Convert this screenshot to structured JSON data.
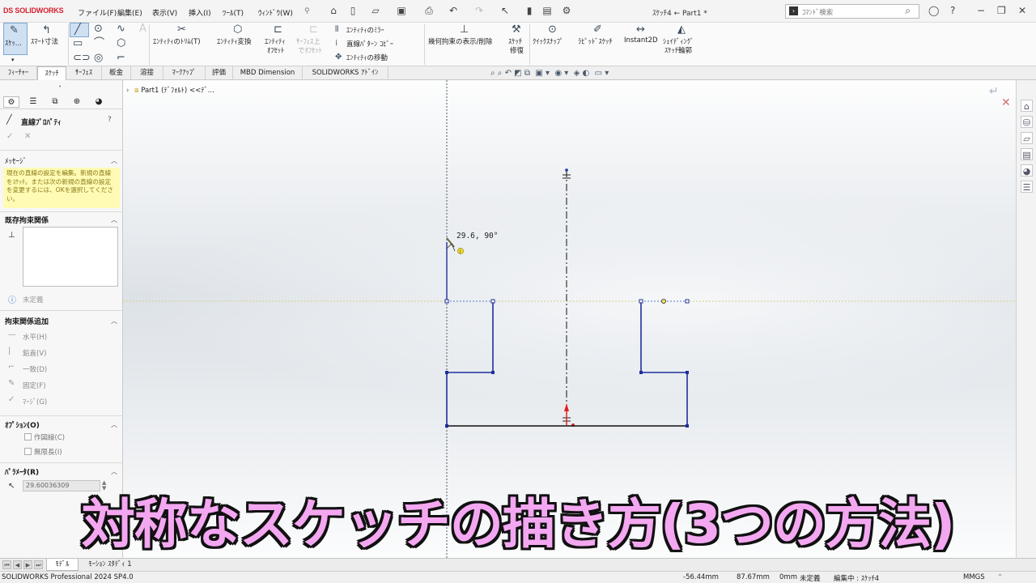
{
  "app": {
    "logo": "DS SOLIDWORKS",
    "doc_title": "ｽｹｯﾁ4 ← Part1 *",
    "menus": [
      "ファイル(F)",
      "編集(E)",
      "表示(V)",
      "挿入(I)",
      "ﾂｰﾙ(T)",
      "ｳｨﾝﾄﾞｳ(W)"
    ],
    "search_placeholder": "ｺﾏﾝﾄﾞ検索"
  },
  "ribbon": {
    "sketch_label": "ｽｹｯ...",
    "smart_dim_label": "ｽﾏｰﾄ寸法",
    "trim_label": "ｴﾝﾃｨﾃｨのﾄﾘﾑ(T)",
    "convert_label": "ｴﾝﾃｨﾃｨ変換",
    "offset_label_1": "ｴﾝﾃｨﾃｨ",
    "offset_label_2": "ｵﾌｾｯﾄ",
    "surface_offset_label_1": "ｻｰﾌｪｽ上",
    "surface_offset_label_2": "でｵﾌｾｯﾄ",
    "mirror_label": "ｴﾝﾃｨﾃｨのﾐﾗｰ",
    "pattern_label": "直線ﾊﾟﾀｰﾝ ｺﾋﾟｰ",
    "move_label": "ｴﾝﾃｨﾃｨの移動",
    "relations_label": "幾何拘束の表示/削除",
    "repair_label_1": "ｽｹｯﾁ",
    "repair_label_2": "修復",
    "quick_snap_label": "ｸｲｯｸｽﾅｯﾌﾟ",
    "rapid_sketch_label": "ﾗﾋﾟｯﾄﾞｽｹｯﾁ",
    "instant2d_label": "Instant2D",
    "shaded_label_1": "ｼｪｲﾃﾞｨﾝｸﾞ",
    "shaded_label_2": "ｽｹｯﾁ輪郭"
  },
  "tabs": [
    "ﾌｨｰﾁｬｰ",
    "ｽｹｯﾁ",
    "ｻｰﾌｪｽ",
    "板金",
    "溶接",
    "ﾏｰｸｱｯﾌﾟ",
    "評価",
    "MBD Dimension",
    "SOLIDWORKS ｱﾄﾞｲﾝ"
  ],
  "active_tab": "ｽｹｯﾁ",
  "panel": {
    "title": "直線ﾌﾟﾛﾊﾟﾃｨ",
    "ok": "✓",
    "cancel": "✕",
    "message_header": "ﾒｯｾｰｼﾞ",
    "message_text": "現在の直線の設定を編集。新規の直線をｽｹｯﾁ。または次の新規の直線の設定を変更するには、OKを選択してください。",
    "existing_header": "既存拘束関係",
    "undefined_label": "未定義",
    "add_header": "拘束関係追加",
    "relations": [
      "水平(H)",
      "鉛直(V)",
      "一致(D)",
      "固定(F)",
      "ﾏｰｼﾞ(G)"
    ],
    "options_header": "ｵﾌﾟｼｮﾝ(O)",
    "options": [
      "作図線(C)",
      "無限長(I)"
    ],
    "params_header": "ﾊﾟﾗﾒｰﾀ(R)",
    "param_value": "29.60036309"
  },
  "canvas": {
    "tree_item": "Part1 (ﾃﾞﾌｫﾙﾄ) <<ﾃﾞ...",
    "dim_readout": "29.6, 90°"
  },
  "bottom_tabs": [
    "ﾓﾃﾞﾙ",
    "ﾓｰｼｮﾝ ｽﾀﾃﾞｨ 1"
  ],
  "active_bottom_tab": "ﾓﾃﾞﾙ",
  "status": {
    "product": "SOLIDWORKS Professional 2024 SP4.0",
    "x": "-56.44mm",
    "y": "87.67mm",
    "z": "0mm",
    "defined": "未定義",
    "editing": "編集中 : ｽｹｯﾁ4",
    "units": "MMGS"
  },
  "caption": "対称なスケッチの描き方(3つの方法)",
  "colors": {
    "sketch_line": "#1f2f9a",
    "centerline": "#111111",
    "caption_fill": "#f4a7f1",
    "message_bg": "#fffbb4",
    "brand_red": "#d5202f"
  }
}
